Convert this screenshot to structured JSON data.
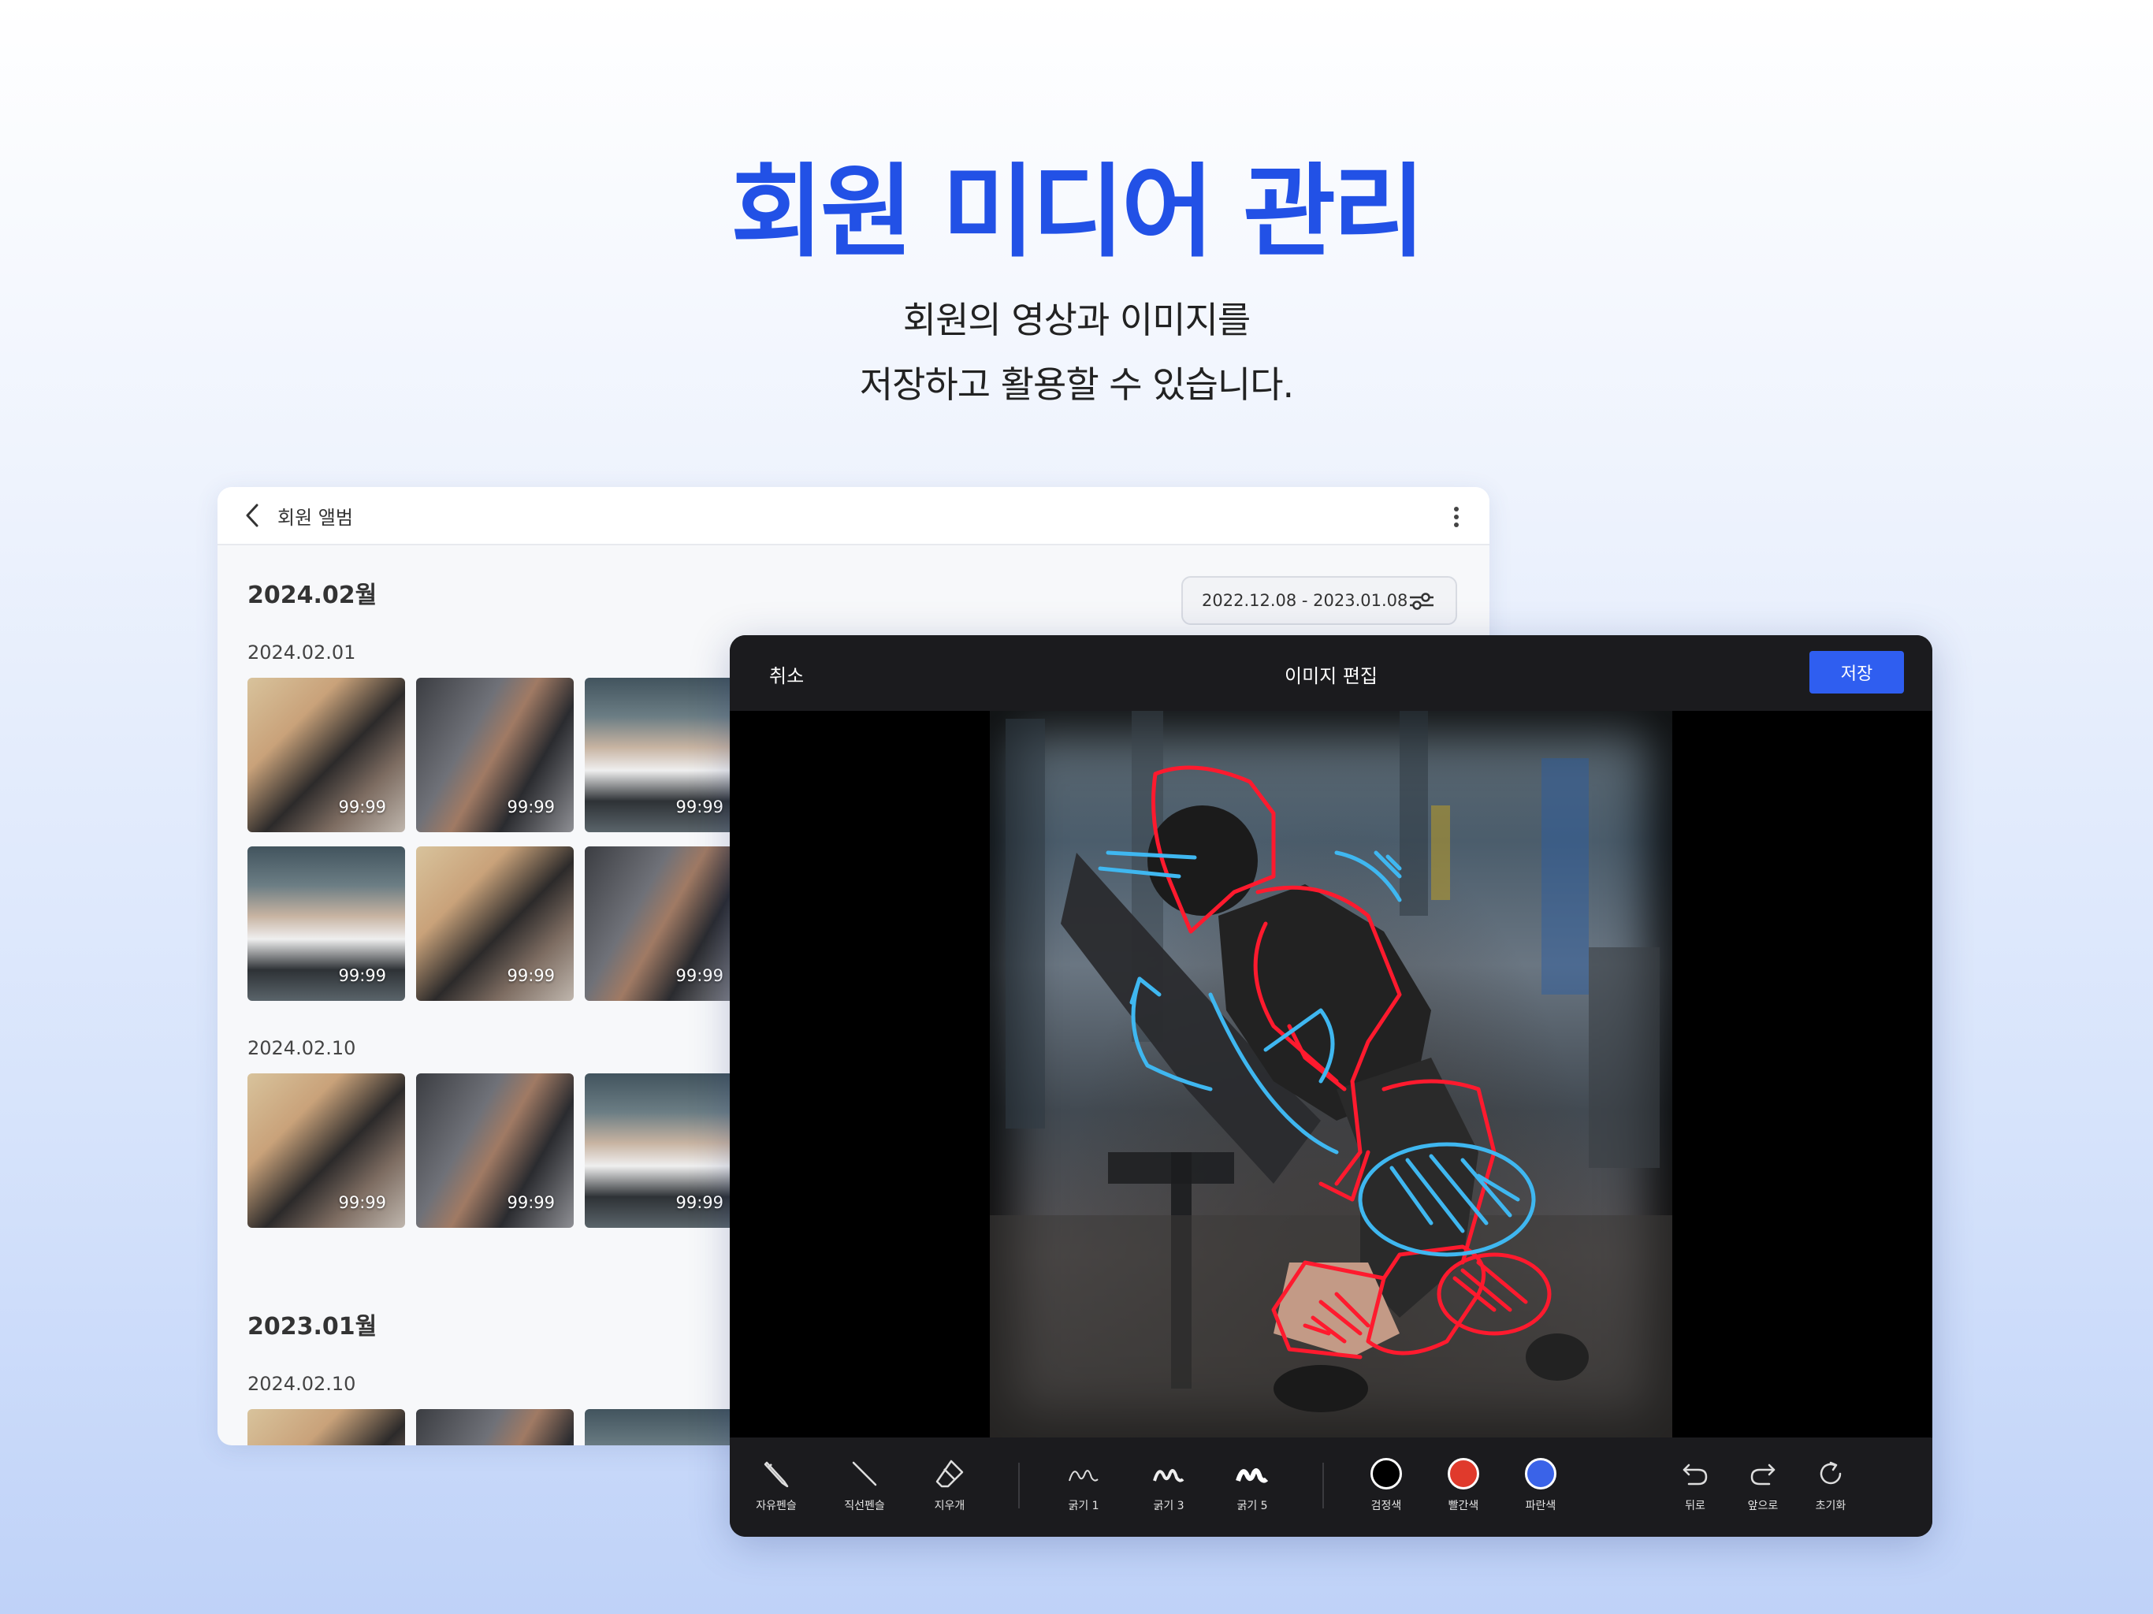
{
  "hero": {
    "title": "회원 미디어 관리",
    "subtitle_line1": "회원의 영상과 이미지를",
    "subtitle_line2": "저장하고 활용할 수 있습니다."
  },
  "album": {
    "header_title": "회원 앨범",
    "date_filter": "2022.12.08 - 2023.01.08",
    "sections": [
      {
        "month": "2024.02월",
        "groups": [
          {
            "date": "2024.02.01",
            "thumbs": [
              "99:99",
              "99:99",
              "99:99",
              "99:99",
              "99:99",
              "99:99"
            ]
          },
          {
            "date": "2024.02.10",
            "thumbs": [
              "99:99",
              "99:99",
              "99:99"
            ]
          }
        ]
      },
      {
        "month": "2023.01월",
        "groups": [
          {
            "date": "2024.02.10",
            "thumbs": []
          }
        ]
      }
    ]
  },
  "editor": {
    "cancel_label": "취소",
    "title": "이미지 편집",
    "save_label": "저장",
    "tools": [
      {
        "label": "자유펜슬",
        "icon": "pencil-icon"
      },
      {
        "label": "직선펜슬",
        "icon": "line-icon"
      },
      {
        "label": "지우개",
        "icon": "eraser-icon"
      }
    ],
    "strokes": [
      {
        "label": "굵기 1",
        "icon": "stroke-thin-icon"
      },
      {
        "label": "굵기 3",
        "icon": "stroke-medium-icon"
      },
      {
        "label": "굵기 5",
        "icon": "stroke-thick-icon"
      }
    ],
    "colors": [
      {
        "label": "검정색",
        "hex": "#000000"
      },
      {
        "label": "빨간색",
        "hex": "#e03a2c"
      },
      {
        "label": "파란색",
        "hex": "#3a63e8"
      }
    ],
    "actions": [
      {
        "label": "뒤로",
        "icon": "undo-icon"
      },
      {
        "label": "앞으로",
        "icon": "redo-icon"
      },
      {
        "label": "초기화",
        "icon": "reset-icon"
      }
    ]
  },
  "colors": {
    "accent": "#2251e6",
    "save_button": "#2f5ef0",
    "editor_bg": "#1b1b1e",
    "annotation_red": "#ff1a2e",
    "annotation_blue": "#3fb7f0"
  }
}
